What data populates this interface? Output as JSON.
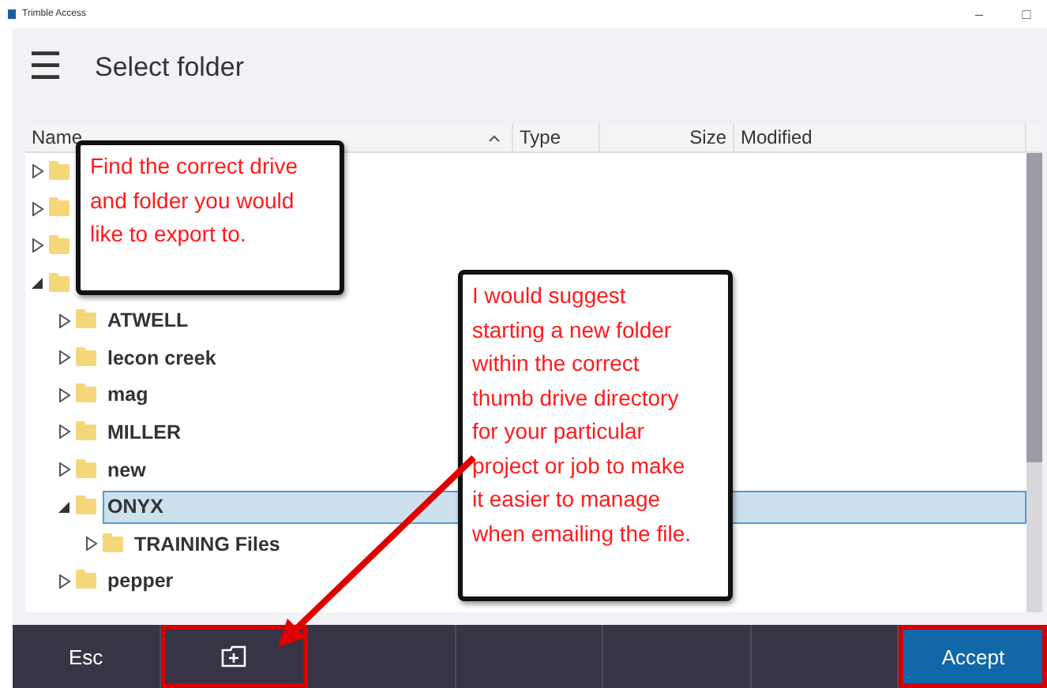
{
  "window": {
    "title": "Trimble Access",
    "controls": [
      "–",
      "□"
    ]
  },
  "header": {
    "menu_icon": "☰",
    "title": "Select folder"
  },
  "table": {
    "columns": [
      {
        "label": "Name",
        "sort_ascending": true
      },
      {
        "label": "Type"
      },
      {
        "label": "Size"
      },
      {
        "label": "Modified"
      }
    ],
    "folders": [
      {
        "expanded": false,
        "selected": false
      },
      {
        "expanded": false,
        "selected": false
      },
      {
        "expanded": false,
        "selected": false
      },
      {
        "expanded": true,
        "selected": false,
        "children": [
          {
            "name": "ATWELL",
            "expanded": false,
            "selected": false
          },
          {
            "name": "lecon creek",
            "expanded": false,
            "selected": false
          },
          {
            "name": "mag",
            "expanded": false,
            "selected": false
          },
          {
            "name": "MILLER",
            "expanded": false,
            "selected": false
          },
          {
            "name": "new",
            "expanded": false,
            "selected": false
          },
          {
            "name": "ONYX",
            "expanded": true,
            "selected": true,
            "children": [
              {
                "name": "TRAINING Files",
                "expanded": false,
                "selected": false
              }
            ]
          },
          {
            "name": "pepper",
            "expanded": false,
            "selected": false
          }
        ]
      }
    ]
  },
  "callouts": [
    {
      "kind": "top",
      "text": "Find the correct drive and folder you would like to export to."
    },
    {
      "kind": "middle",
      "text": "I would suggest starting a new folder within the correct thumb drive directory for your particular project or job to make it easier to manage when emailing the file."
    }
  ],
  "buttons": [
    {
      "kind": "text",
      "label": "Esc",
      "highlighted": false
    },
    {
      "kind": "new-folder",
      "highlighted": true
    },
    {
      "kind": "blank",
      "highlighted": false
    },
    {
      "kind": "blank",
      "highlighted": false
    },
    {
      "kind": "blank",
      "highlighted": false
    },
    {
      "kind": "blank",
      "highlighted": false
    },
    {
      "kind": "primary",
      "label": "Accept",
      "highlighted": true
    }
  ]
}
